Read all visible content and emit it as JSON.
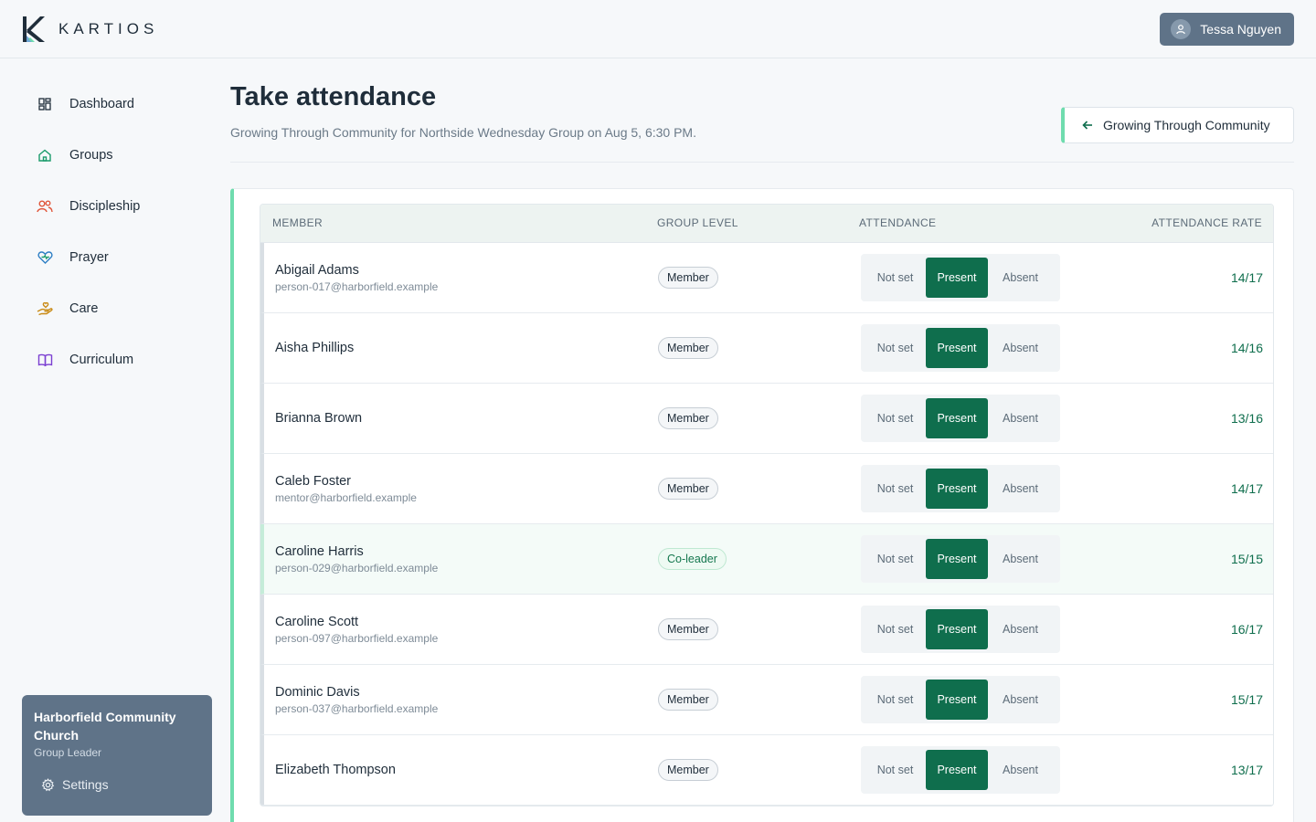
{
  "brand": {
    "name": "KARTIOS"
  },
  "user": {
    "name": "Tessa Nguyen"
  },
  "nav": [
    {
      "label": "Dashboard",
      "icon": "dashboard-icon"
    },
    {
      "label": "Groups",
      "icon": "home-icon"
    },
    {
      "label": "Discipleship",
      "icon": "people-icon"
    },
    {
      "label": "Prayer",
      "icon": "heart-icon"
    },
    {
      "label": "Care",
      "icon": "hand-heart-icon"
    },
    {
      "label": "Curriculum",
      "icon": "book-icon"
    }
  ],
  "church": {
    "name": "Harborfield Community Church",
    "role": "Group Leader",
    "settings_label": "Settings"
  },
  "page": {
    "title": "Take attendance",
    "subtitle": "Growing Through Community for Northside Wednesday Group on Aug 5, 6:30 PM.",
    "back_label": "Growing Through Community"
  },
  "table": {
    "columns": [
      "MEMBER",
      "GROUP LEVEL",
      "ATTENDANCE",
      "ATTENDANCE RATE"
    ],
    "options": {
      "not_set": "Not set",
      "present": "Present",
      "absent": "Absent"
    },
    "rows": [
      {
        "name": "Abigail Adams",
        "email": "person-017@harborfield.example",
        "level": "Member",
        "rate": "14/17"
      },
      {
        "name": "Aisha Phillips",
        "email": "",
        "level": "Member",
        "rate": "14/16"
      },
      {
        "name": "Brianna Brown",
        "email": "",
        "level": "Member",
        "rate": "13/16"
      },
      {
        "name": "Caleb Foster",
        "email": "mentor@harborfield.example",
        "level": "Member",
        "rate": "14/17"
      },
      {
        "name": "Caroline Harris",
        "email": "person-029@harborfield.example",
        "level": "Co-leader",
        "rate": "15/15"
      },
      {
        "name": "Caroline Scott",
        "email": "person-097@harborfield.example",
        "level": "Member",
        "rate": "16/17"
      },
      {
        "name": "Dominic Davis",
        "email": "person-037@harborfield.example",
        "level": "Member",
        "rate": "15/17"
      },
      {
        "name": "Elizabeth Thompson",
        "email": "",
        "level": "Member",
        "rate": "13/17"
      }
    ]
  },
  "colors": {
    "accent": "#0f6e4d",
    "accent_border": "#6fdcae",
    "slate": "#5f7388"
  }
}
